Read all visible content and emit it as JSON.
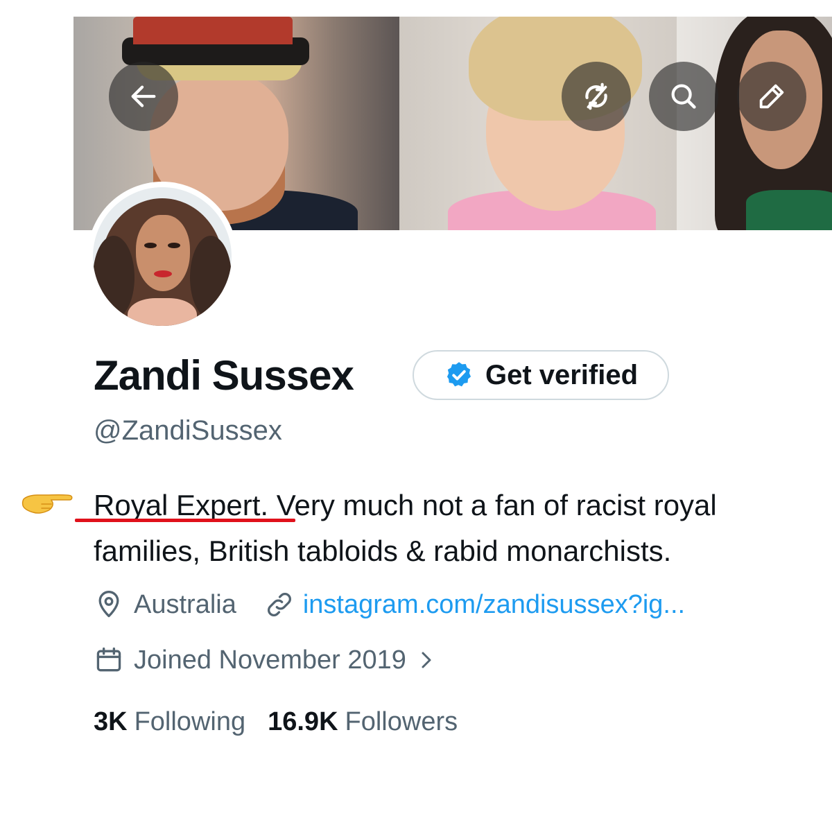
{
  "profile": {
    "display_name": "Zandi Sussex",
    "handle": "@ZandiSussex",
    "verify_button_label": "Get verified",
    "bio_highlight": "Royal Expert.",
    "bio_rest": " Very much not a fan of racist royal families, British tabloids & rabid monarchists.",
    "location": "Australia",
    "website": "instagram.com/zandisussex?ig...",
    "joined": "Joined November 2019"
  },
  "stats": {
    "following_count": "3K",
    "following_label": "Following",
    "followers_count": "16.9K",
    "followers_label": "Followers"
  },
  "banner_actions": {
    "back": "back-arrow-icon",
    "sync": "sync-icon",
    "search": "search-icon",
    "edit": "edit-pencil-icon"
  },
  "colors": {
    "text_primary": "#0f1419",
    "text_secondary": "#536471",
    "link": "#1d9bf0",
    "verified_badge": "#1d9bf0",
    "annotation_underline": "#e0111b"
  }
}
